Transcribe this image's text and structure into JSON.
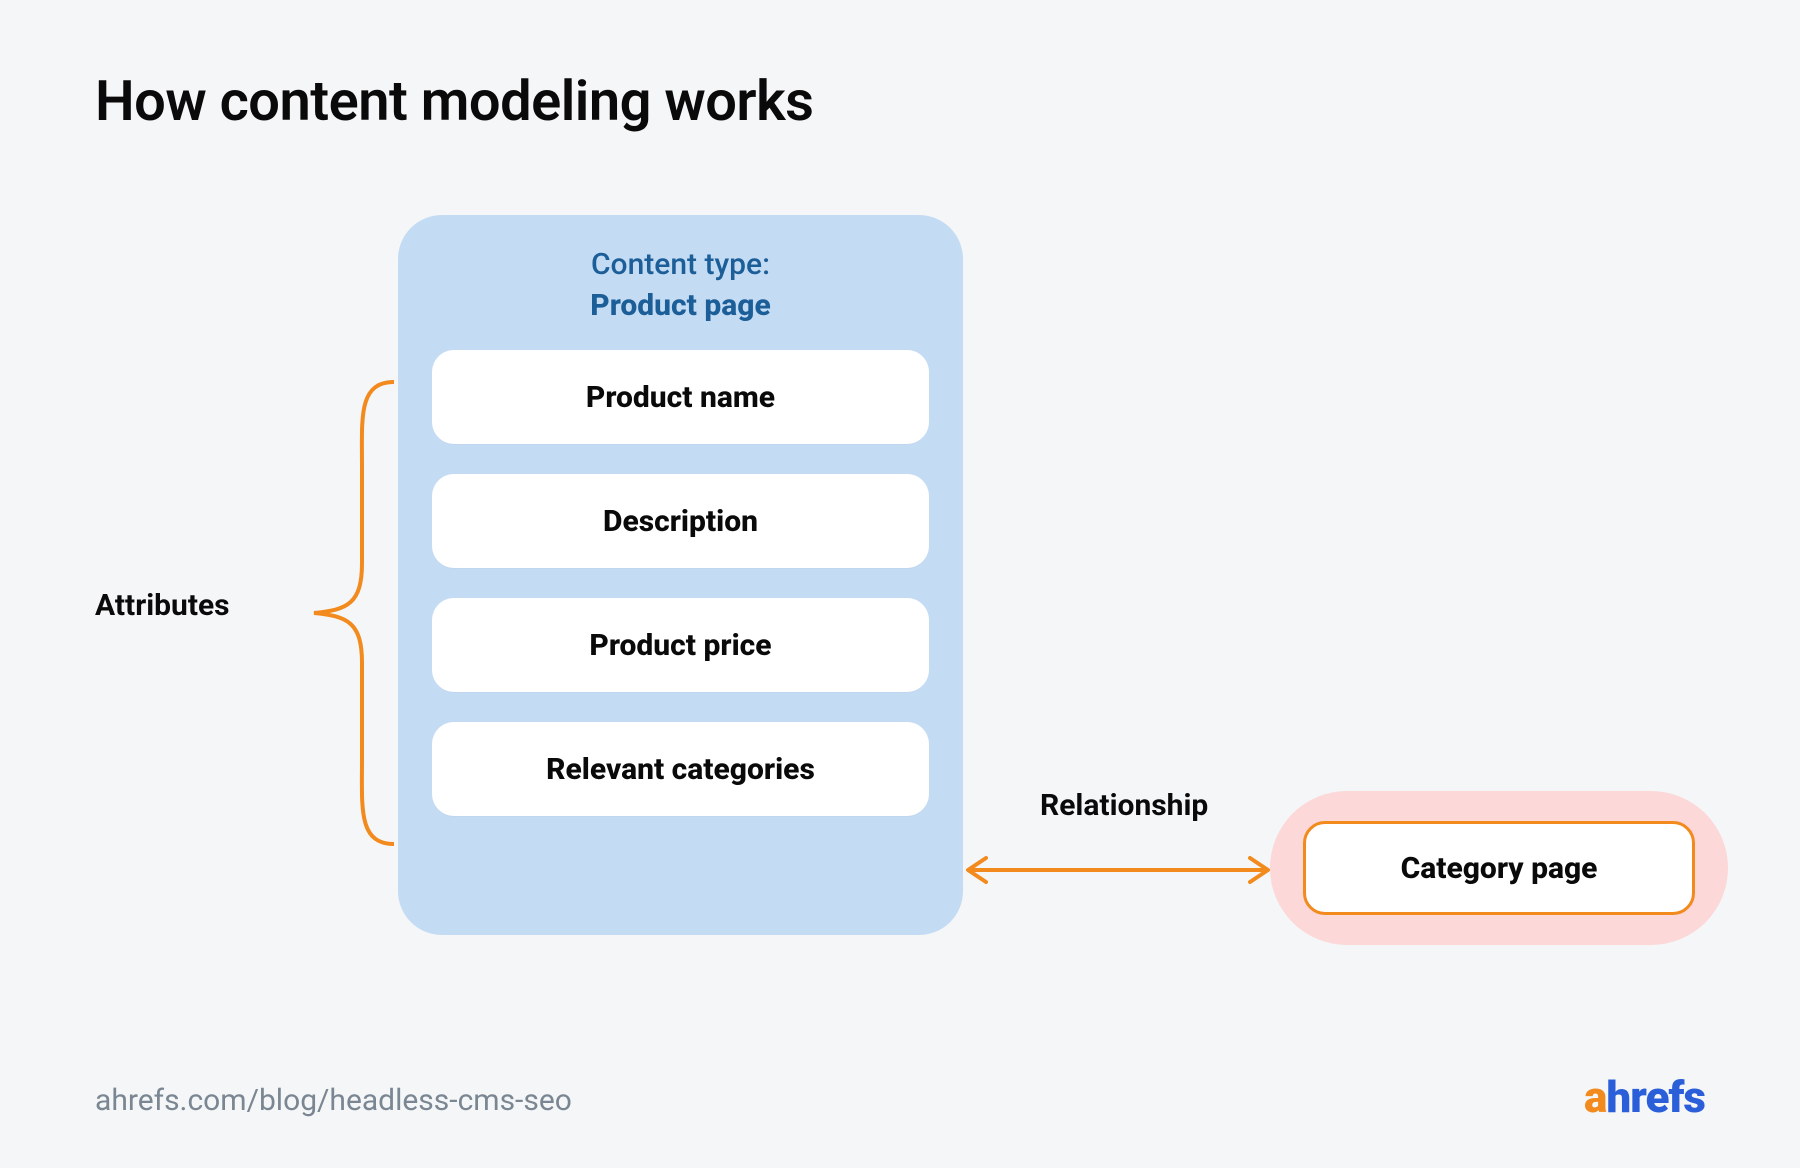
{
  "title": "How content modeling works",
  "content_type": {
    "label": "Content type:",
    "name": "Product page",
    "attributes": [
      "Product name",
      "Description",
      "Product price",
      "Relevant categories"
    ]
  },
  "labels": {
    "attributes": "Attributes",
    "relationship": "Relationship"
  },
  "related_type": "Category page",
  "footer_url": "ahrefs.com/blog/headless-cms-seo",
  "brand": {
    "first": "a",
    "rest": "hrefs"
  },
  "colors": {
    "bg": "#f4f6f8",
    "box_blue": "#c4dbf4",
    "text_blue": "#1c5e98",
    "accent_orange": "#f28a1d",
    "box_pink": "#fcd8d8",
    "muted": "#7a8691",
    "brand_blue": "#2b5fd9"
  }
}
